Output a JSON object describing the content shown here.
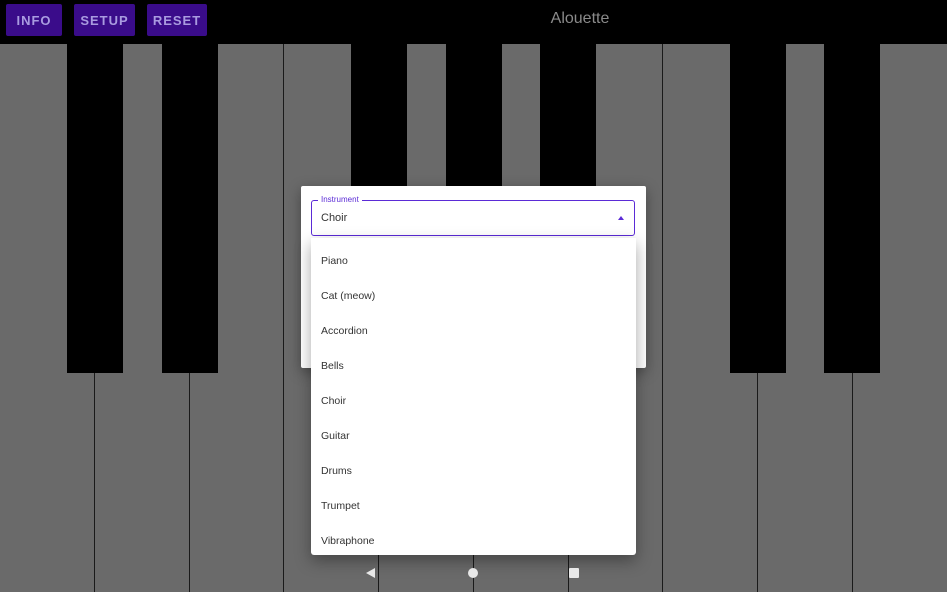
{
  "toolbar": {
    "info_label": "INFO",
    "setup_label": "SETUP",
    "reset_label": "RESET",
    "title": "Alouette",
    "button_color": "#3a0c8a"
  },
  "keyboard": {
    "white_key_color": "#6a6a6a",
    "black_key_color": "#000000"
  },
  "instrument_select": {
    "label": "Instrument",
    "selected": "Choir",
    "accent_color": "#5b2bd6",
    "arrow_icon": "caret-up-icon"
  },
  "dropdown": {
    "options": [
      "Piano",
      "Cat (meow)",
      "Accordion",
      "Bells",
      "Choir",
      "Guitar",
      "Drums",
      "Trumpet",
      "Vibraphone"
    ]
  },
  "navbar": {
    "back_icon": "back-triangle-icon",
    "home_icon": "home-circle-icon",
    "recents_icon": "recents-square-icon"
  }
}
